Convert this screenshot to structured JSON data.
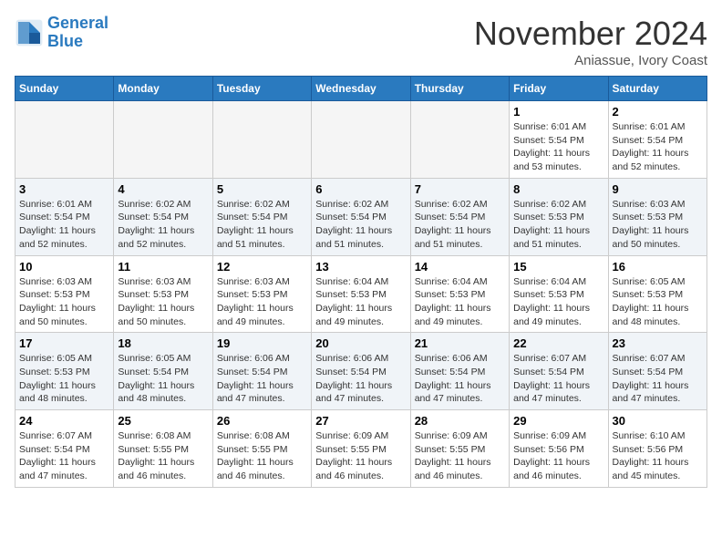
{
  "logo": {
    "line1": "General",
    "line2": "Blue"
  },
  "title": "November 2024",
  "location": "Aniassue, Ivory Coast",
  "weekdays": [
    "Sunday",
    "Monday",
    "Tuesday",
    "Wednesday",
    "Thursday",
    "Friday",
    "Saturday"
  ],
  "weeks": [
    [
      {
        "day": "",
        "empty": true
      },
      {
        "day": "",
        "empty": true
      },
      {
        "day": "",
        "empty": true
      },
      {
        "day": "",
        "empty": true
      },
      {
        "day": "",
        "empty": true
      },
      {
        "day": "1",
        "sunrise": "6:01 AM",
        "sunset": "5:54 PM",
        "daylight": "11 hours and 53 minutes."
      },
      {
        "day": "2",
        "sunrise": "6:01 AM",
        "sunset": "5:54 PM",
        "daylight": "11 hours and 52 minutes."
      }
    ],
    [
      {
        "day": "3",
        "sunrise": "6:01 AM",
        "sunset": "5:54 PM",
        "daylight": "11 hours and 52 minutes."
      },
      {
        "day": "4",
        "sunrise": "6:02 AM",
        "sunset": "5:54 PM",
        "daylight": "11 hours and 52 minutes."
      },
      {
        "day": "5",
        "sunrise": "6:02 AM",
        "sunset": "5:54 PM",
        "daylight": "11 hours and 51 minutes."
      },
      {
        "day": "6",
        "sunrise": "6:02 AM",
        "sunset": "5:54 PM",
        "daylight": "11 hours and 51 minutes."
      },
      {
        "day": "7",
        "sunrise": "6:02 AM",
        "sunset": "5:54 PM",
        "daylight": "11 hours and 51 minutes."
      },
      {
        "day": "8",
        "sunrise": "6:02 AM",
        "sunset": "5:53 PM",
        "daylight": "11 hours and 51 minutes."
      },
      {
        "day": "9",
        "sunrise": "6:03 AM",
        "sunset": "5:53 PM",
        "daylight": "11 hours and 50 minutes."
      }
    ],
    [
      {
        "day": "10",
        "sunrise": "6:03 AM",
        "sunset": "5:53 PM",
        "daylight": "11 hours and 50 minutes."
      },
      {
        "day": "11",
        "sunrise": "6:03 AM",
        "sunset": "5:53 PM",
        "daylight": "11 hours and 50 minutes."
      },
      {
        "day": "12",
        "sunrise": "6:03 AM",
        "sunset": "5:53 PM",
        "daylight": "11 hours and 49 minutes."
      },
      {
        "day": "13",
        "sunrise": "6:04 AM",
        "sunset": "5:53 PM",
        "daylight": "11 hours and 49 minutes."
      },
      {
        "day": "14",
        "sunrise": "6:04 AM",
        "sunset": "5:53 PM",
        "daylight": "11 hours and 49 minutes."
      },
      {
        "day": "15",
        "sunrise": "6:04 AM",
        "sunset": "5:53 PM",
        "daylight": "11 hours and 49 minutes."
      },
      {
        "day": "16",
        "sunrise": "6:05 AM",
        "sunset": "5:53 PM",
        "daylight": "11 hours and 48 minutes."
      }
    ],
    [
      {
        "day": "17",
        "sunrise": "6:05 AM",
        "sunset": "5:53 PM",
        "daylight": "11 hours and 48 minutes."
      },
      {
        "day": "18",
        "sunrise": "6:05 AM",
        "sunset": "5:54 PM",
        "daylight": "11 hours and 48 minutes."
      },
      {
        "day": "19",
        "sunrise": "6:06 AM",
        "sunset": "5:54 PM",
        "daylight": "11 hours and 47 minutes."
      },
      {
        "day": "20",
        "sunrise": "6:06 AM",
        "sunset": "5:54 PM",
        "daylight": "11 hours and 47 minutes."
      },
      {
        "day": "21",
        "sunrise": "6:06 AM",
        "sunset": "5:54 PM",
        "daylight": "11 hours and 47 minutes."
      },
      {
        "day": "22",
        "sunrise": "6:07 AM",
        "sunset": "5:54 PM",
        "daylight": "11 hours and 47 minutes."
      },
      {
        "day": "23",
        "sunrise": "6:07 AM",
        "sunset": "5:54 PM",
        "daylight": "11 hours and 47 minutes."
      }
    ],
    [
      {
        "day": "24",
        "sunrise": "6:07 AM",
        "sunset": "5:54 PM",
        "daylight": "11 hours and 47 minutes."
      },
      {
        "day": "25",
        "sunrise": "6:08 AM",
        "sunset": "5:55 PM",
        "daylight": "11 hours and 46 minutes."
      },
      {
        "day": "26",
        "sunrise": "6:08 AM",
        "sunset": "5:55 PM",
        "daylight": "11 hours and 46 minutes."
      },
      {
        "day": "27",
        "sunrise": "6:09 AM",
        "sunset": "5:55 PM",
        "daylight": "11 hours and 46 minutes."
      },
      {
        "day": "28",
        "sunrise": "6:09 AM",
        "sunset": "5:55 PM",
        "daylight": "11 hours and 46 minutes."
      },
      {
        "day": "29",
        "sunrise": "6:09 AM",
        "sunset": "5:56 PM",
        "daylight": "11 hours and 46 minutes."
      },
      {
        "day": "30",
        "sunrise": "6:10 AM",
        "sunset": "5:56 PM",
        "daylight": "11 hours and 45 minutes."
      }
    ]
  ]
}
